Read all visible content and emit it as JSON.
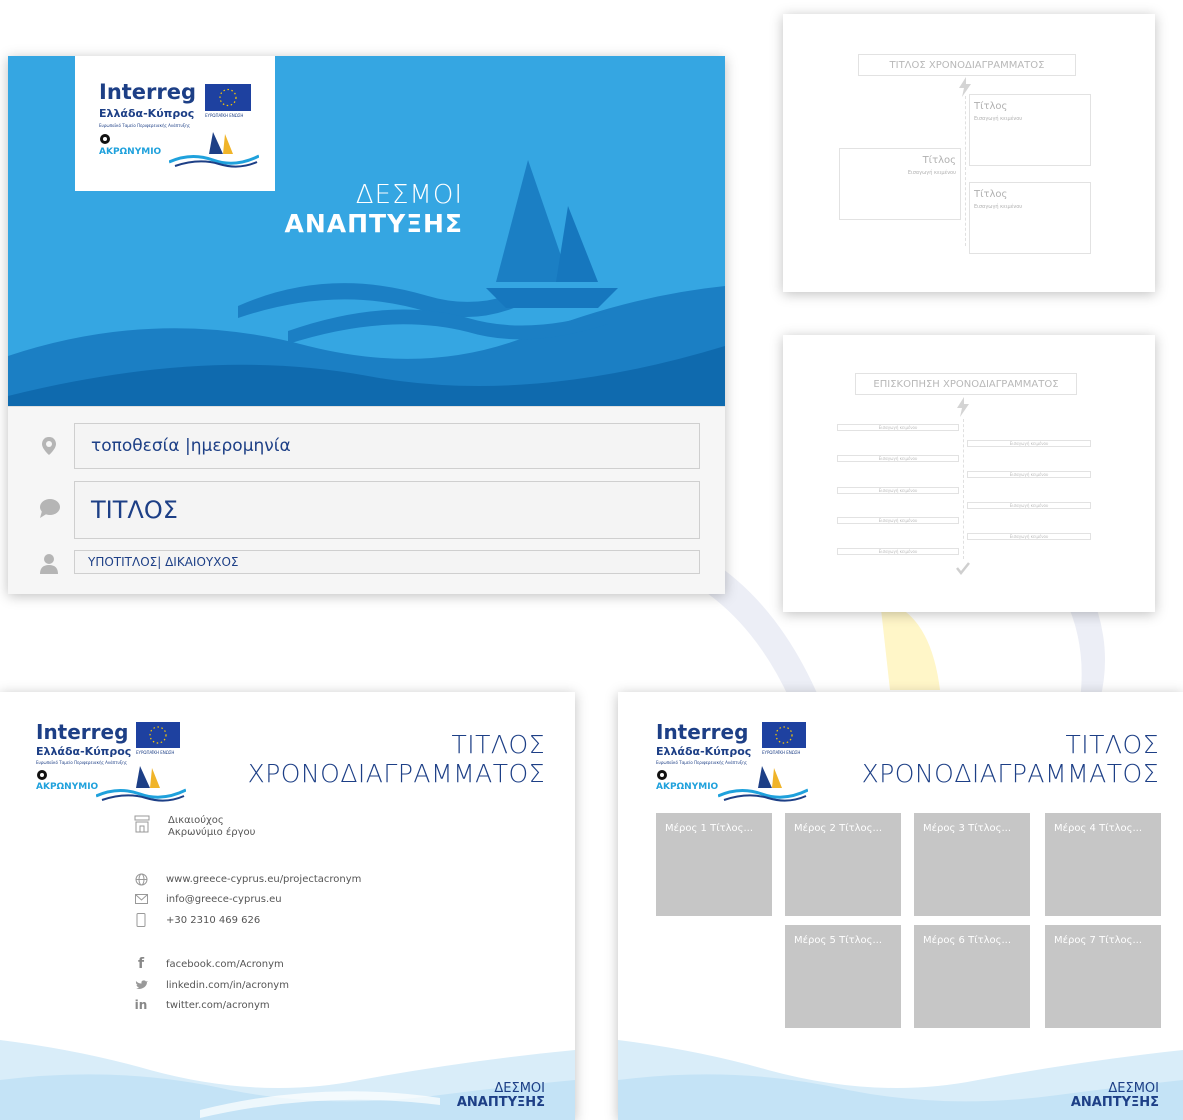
{
  "brand": {
    "interreg": "Interreg",
    "country": "Ελλάδα-Κύπρος",
    "fund": "Ευρωπαϊκό Ταμείο Περιφερειακής Ανάπτυξης",
    "eu_label": "ΕΥΡΩΠΑΪΚΗ ΕΝΩΣΗ",
    "acronym": "ΑΚΡΩΝΥΜΙΟ",
    "tagline_line1": "ΔΕΣΜΟΙ",
    "tagline_line2": "ΑΝΑΠΤΥΞΗΣ"
  },
  "main_slide": {
    "location_date": "τοποθεσία |ημερομηνία",
    "title": "ΤΙΤΛΟΣ",
    "subtitle": "ΥΠΟΤΙΤΛΟΣ| ΔΙΚΑΙΟΥΧΟΣ"
  },
  "timeline_slide": {
    "title": "ΤΙΤΛΟΣ ΧΡΟΝΟΔΙΑΓΡΑΜΜΑΤΟΣ",
    "items": [
      {
        "heading": "Τίτλος",
        "text": "Εισαγωγή κειμένου"
      },
      {
        "heading": "Τίτλος",
        "text": "Εισαγωγή κειμένου"
      },
      {
        "heading": "Τίτλος",
        "text": "Εισαγωγή κειμένου"
      }
    ]
  },
  "overview_slide": {
    "title": "ΕΠΙΣΚΟΠΗΣΗ ΧΡΟΝΟΔΙΑΓΡΑΜΜΑΤΟΣ",
    "entry_text": "Εισαγωγή κειμένου"
  },
  "contact_slide": {
    "title_line1": "ΤΙΤΛΟΣ",
    "title_line2": "ΧΡΟΝΟΔΙΑΓΡΑΜΜΑΤΟΣ",
    "beneficiary_line1": "Δικαιούχος",
    "beneficiary_line2": "Ακρωνύμιο έργου",
    "website": "www.greece-cyprus.eu/projectacronym",
    "email": "info@greece-cyprus.eu",
    "phone": "+30  2310 469 626",
    "facebook": "facebook.com/Acronym",
    "linkedin": "linkedin.com/in/acronym",
    "twitter": "twitter.com/acronym"
  },
  "gallery_slide": {
    "title_line1": "ΤΙΤΛΟΣ",
    "title_line2": "ΧΡΟΝΟΔΙΑΓΡΑΜΜΑΤΟΣ",
    "tiles": [
      "Μέρος 1 Τίτλος...",
      "Μέρος 2 Τίτλος...",
      "Μέρος 3 Τίτλος...",
      "Μέρος 4 Τίτλος...",
      "Μέρος 5 Τίτλος...",
      "Μέρος 6 Τίτλος...",
      "Μέρος 7 Τίτλος..."
    ]
  },
  "colors": {
    "brand_blue": "#1d3f86",
    "hero_blue": "#35a6e2",
    "wave_dark": "#1677be",
    "tile_gray": "#c6c6c6",
    "eu_blue": "#1e41a0"
  }
}
